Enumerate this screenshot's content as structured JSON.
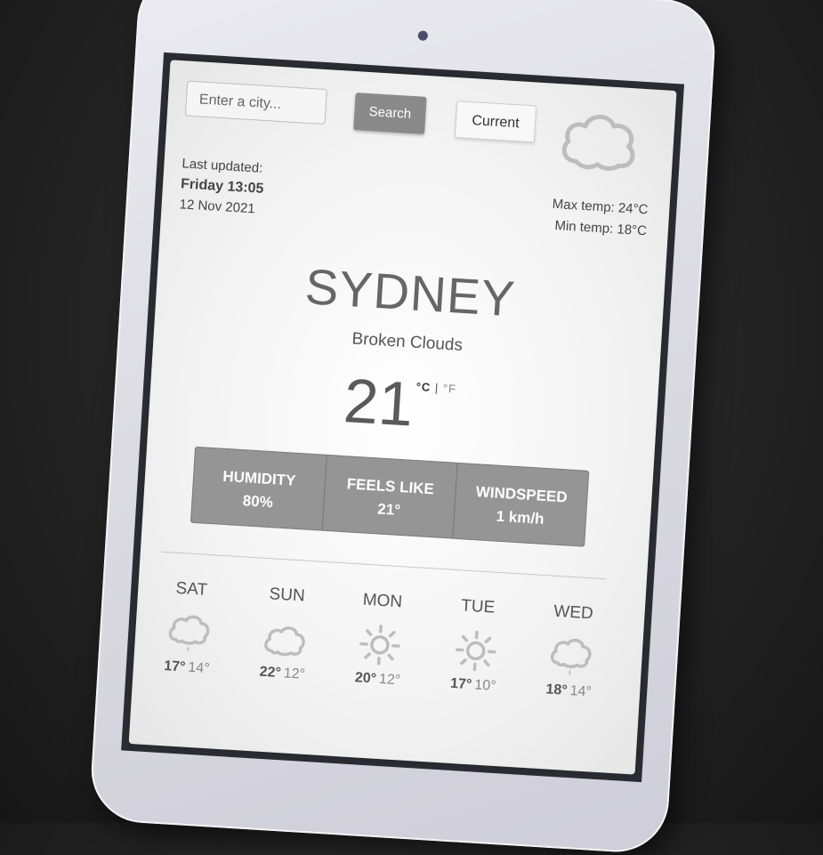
{
  "search": {
    "placeholder": "Enter a city...",
    "button_label": "Search"
  },
  "current_button_label": "Current",
  "main_icon": "cloud-icon",
  "last_updated": {
    "label": "Last updated:",
    "day_time": "Friday 13:05",
    "date": "12 Nov 2021"
  },
  "temp_range": {
    "max": "Max temp: 24°C",
    "min": "Min temp: 18°C"
  },
  "city": "SYDNEY",
  "description": "Broken Clouds",
  "temperature": "21",
  "units": {
    "celsius": "°C",
    "separator": "|",
    "fahrenheit": "°F"
  },
  "stats": [
    {
      "label": "HUMIDITY",
      "value": "80%"
    },
    {
      "label": "FEELS LIKE",
      "value": "21°"
    },
    {
      "label": "WINDSPEED",
      "value": "1 km/h"
    }
  ],
  "forecast": [
    {
      "day": "SAT",
      "icon": "rain-icon",
      "hi": "17°",
      "lo": "14°"
    },
    {
      "day": "SUN",
      "icon": "cloud-icon",
      "hi": "22°",
      "lo": "12°"
    },
    {
      "day": "MON",
      "icon": "sun-icon",
      "hi": "20°",
      "lo": "12°"
    },
    {
      "day": "TUE",
      "icon": "sun-icon",
      "hi": "17°",
      "lo": "10°"
    },
    {
      "day": "WED",
      "icon": "rain-icon",
      "hi": "18°",
      "lo": "14°"
    }
  ],
  "colors": {
    "stats_bg": "#959595",
    "search_btn": "#8a8a8a",
    "background": "#242424"
  }
}
